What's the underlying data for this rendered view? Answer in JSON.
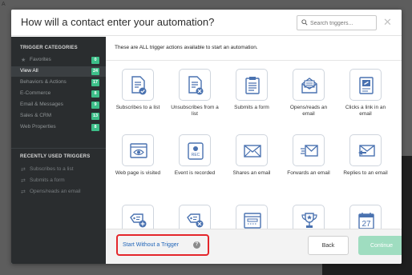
{
  "background": {
    "corner_text": "A"
  },
  "header": {
    "title": "How will a contact enter your automation?",
    "search_placeholder": "Search triggers...",
    "close_glyph": "✕"
  },
  "sidebar": {
    "categories_heading": "TRIGGER CATEGORIES",
    "categories": [
      {
        "label": "Favorites",
        "count": "0",
        "icon": "star-icon",
        "active": false
      },
      {
        "label": "View All",
        "count": "24",
        "active": true
      },
      {
        "label": "Behaviors & Actions",
        "count": "17",
        "active": false
      },
      {
        "label": "E-Commerce",
        "count": "8",
        "active": false
      },
      {
        "label": "Email & Messages",
        "count": "9",
        "active": false
      },
      {
        "label": "Sales & CRM",
        "count": "13",
        "active": false
      },
      {
        "label": "Web Properties",
        "count": "8",
        "active": false
      }
    ],
    "recent_heading": "RECENTLY USED TRIGGERS",
    "recent": [
      {
        "label": "Subscribes to a list",
        "icon": "swap-icon"
      },
      {
        "label": "Submits a form",
        "icon": "swap-icon"
      },
      {
        "label": "Opens/reads an email",
        "icon": "swap-icon"
      }
    ]
  },
  "main": {
    "description": "These are ALL trigger actions available to start an automation.",
    "triggers": [
      {
        "label": "Subscribes to a list",
        "icon": "document-check-icon"
      },
      {
        "label": "Unsubscribes from a list",
        "icon": "document-remove-icon"
      },
      {
        "label": "Submits a form",
        "icon": "clipboard-form-icon"
      },
      {
        "label": "Opens/reads an email",
        "icon": "open-envelope-icon"
      },
      {
        "label": "Clicks a link in an email",
        "icon": "link-document-icon"
      },
      {
        "label": "Web page is visited",
        "icon": "browser-eye-icon"
      },
      {
        "label": "Event is recorded",
        "icon": "record-rec-icon"
      },
      {
        "label": "Shares an email",
        "icon": "envelope-share-icon"
      },
      {
        "label": "Forwards an email",
        "icon": "envelope-forward-icon"
      },
      {
        "label": "Replies to an email",
        "icon": "envelope-reply-icon"
      },
      {
        "label": "",
        "icon": "tag-add-icon"
      },
      {
        "label": "",
        "icon": "tag-remove-icon"
      },
      {
        "label": "",
        "icon": "web-form-icon"
      },
      {
        "label": "",
        "icon": "trophy-icon"
      },
      {
        "label": "",
        "icon": "calendar-icon",
        "day": "27"
      }
    ]
  },
  "footer": {
    "start_without_trigger": "Start Without a Trigger",
    "help_glyph": "?",
    "back_label": "Back",
    "continue_label": "Continue"
  },
  "colors": {
    "sidebar_bg": "#2a2d2f",
    "badge_green": "#3dbf89",
    "icon_blue": "#4a72b0",
    "highlight_red": "#e4262b",
    "link_blue": "#1f64b8",
    "continue_disabled": "#9fddc0"
  }
}
